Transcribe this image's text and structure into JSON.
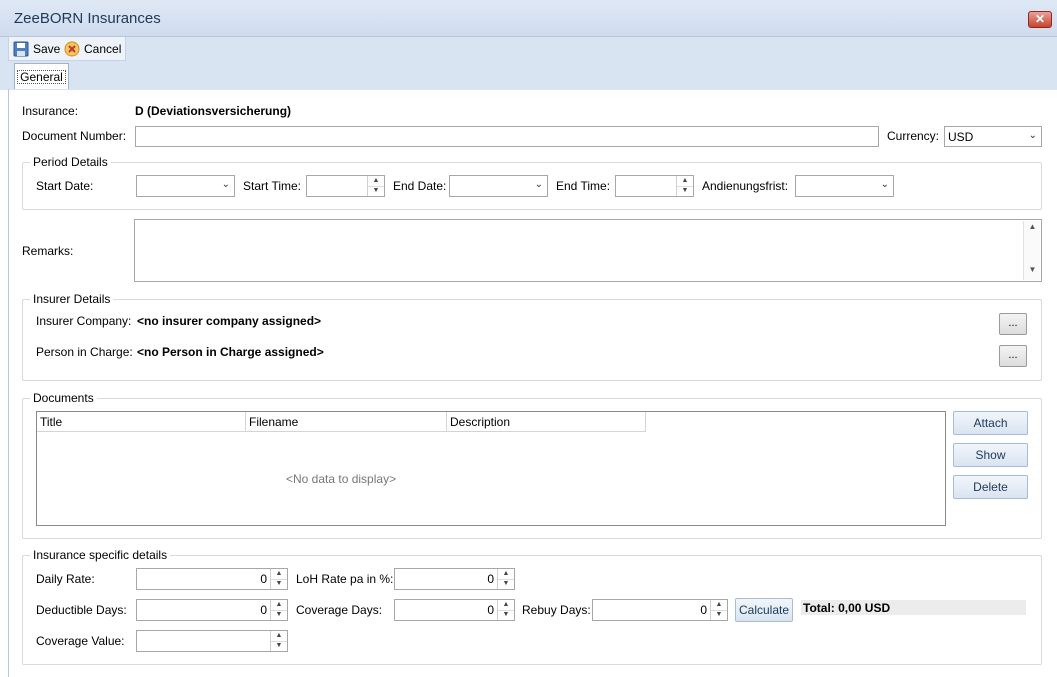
{
  "window": {
    "title": "ZeeBORN Insurances",
    "close_label": "✕"
  },
  "toolbar": {
    "save_label": "Save",
    "cancel_label": "Cancel"
  },
  "tabs": [
    {
      "label": "General"
    }
  ],
  "form": {
    "insurance_label": "Insurance:",
    "insurance_value": "D (Deviationsversicherung)",
    "document_number_label": "Document Number:",
    "document_number_value": "",
    "currency_label": "Currency:",
    "currency_value": "USD",
    "remarks_label": "Remarks:",
    "remarks_value": ""
  },
  "period": {
    "title": "Period Details",
    "start_date_label": "Start Date:",
    "start_time_label": "Start Time:",
    "end_date_label": "End Date:",
    "end_time_label": "End Time:",
    "andienungsfrist_label": "Andienungsfrist:"
  },
  "insurer": {
    "title": "Insurer Details",
    "company_label": "Insurer Company:",
    "company_value": "<no insurer company assigned>",
    "person_label": "Person in Charge:",
    "person_value": "<no Person in Charge assigned>",
    "ellipsis": "..."
  },
  "documents": {
    "title": "Documents",
    "columns": [
      "Title",
      "Filename",
      "Description"
    ],
    "empty_text": "<No data to display>",
    "attach_label": "Attach",
    "show_label": "Show",
    "delete_label": "Delete"
  },
  "specific": {
    "title": "Insurance specific details",
    "daily_rate_label": "Daily Rate:",
    "daily_rate_value": "0",
    "loh_rate_label": "LoH Rate pa in %:",
    "loh_rate_value": "0",
    "deductible_days_label": "Deductible Days:",
    "deductible_days_value": "0",
    "coverage_days_label": "Coverage Days:",
    "coverage_days_value": "0",
    "rebuy_days_label": "Rebuy Days:",
    "rebuy_days_value": "0",
    "calculate_label": "Calculate",
    "total_text": "Total: 0,00 USD",
    "coverage_value_label": "Coverage Value:",
    "coverage_value_value": ""
  },
  "icons": {
    "save": "floppy-disk-icon",
    "cancel": "cancel-circle-icon",
    "dropdown": "chevron-down-icon",
    "spin_up": "spin-up-icon",
    "spin_down": "spin-down-icon"
  }
}
